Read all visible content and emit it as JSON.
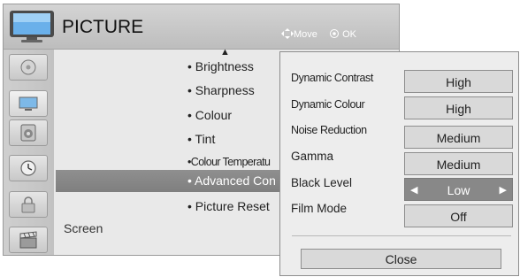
{
  "header": {
    "title": "PICTURE",
    "move_hint": "Move",
    "ok_hint": "OK",
    "icon": "tv-icon"
  },
  "sidebar": {
    "items": [
      {
        "icon": "disc-icon"
      },
      {
        "icon": "monitor-icon"
      },
      {
        "icon": "speaker-icon"
      },
      {
        "icon": "clock-icon"
      },
      {
        "icon": "lock-icon"
      },
      {
        "icon": "clapperboard-icon"
      }
    ]
  },
  "menu": {
    "items": [
      {
        "label": "• Brightness"
      },
      {
        "label": "• Sharpness"
      },
      {
        "label": "• Colour"
      },
      {
        "label": "• Tint"
      },
      {
        "label": "•Colour Temperatu"
      },
      {
        "label": "• Advanced Con"
      },
      {
        "label": "• Picture Reset"
      }
    ],
    "selected_index": 5,
    "footer_label": "Screen"
  },
  "advanced": {
    "rows": [
      {
        "label": "Dynamic Contrast",
        "value": "High"
      },
      {
        "label": "Dynamic Colour",
        "value": "High"
      },
      {
        "label": "Noise Reduction",
        "value": "Medium"
      },
      {
        "label": "Gamma",
        "value": "Medium"
      },
      {
        "label": "Black Level",
        "value": "Low"
      },
      {
        "label": "Film Mode",
        "value": "Off"
      }
    ],
    "active_index": 4,
    "close_label": "Close"
  },
  "colors": {
    "selection_bg": "#888888",
    "header_bg": "#c8c8c8",
    "panel_bg": "#ededed"
  }
}
